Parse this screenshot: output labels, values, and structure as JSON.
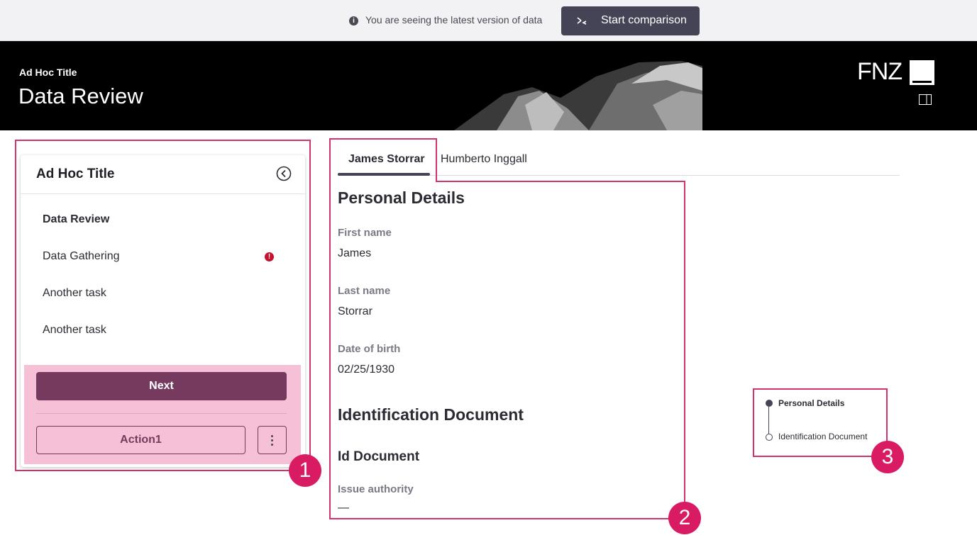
{
  "topbar": {
    "info_icon": "info-icon",
    "info_text": "You are seeing the latest version of data",
    "compare_icon": "compare-arrows-icon",
    "compare_label": "Start comparison"
  },
  "header": {
    "subtitle": "Ad Hoc Title",
    "title": "Data Review",
    "logo_text": "FNZ",
    "panel_icon": "side-panel-icon"
  },
  "sidebar": {
    "title": "Ad Hoc Title",
    "collapse_icon": "chevron-left-circle-icon",
    "items": [
      {
        "label": "Data Review",
        "active": true
      },
      {
        "label": "Data Gathering",
        "alert": true,
        "alert_icon": "error-icon"
      },
      {
        "label": "Another task"
      },
      {
        "label": "Another task"
      }
    ],
    "next_label": "Next",
    "action_label": "Action1",
    "more_icon": "more-vertical-icon"
  },
  "tabs": [
    {
      "label": "James Storrar",
      "active": true
    },
    {
      "label": "Humberto Inggall",
      "active": false
    }
  ],
  "content": {
    "personal_title": "Personal Details",
    "fields": [
      {
        "label": "First name",
        "value": "James"
      },
      {
        "label": "Last name",
        "value": "Storrar"
      },
      {
        "label": "Date of birth",
        "value": "02/25/1930"
      }
    ],
    "identification_title": "Identification Document",
    "id_document_title": "Id Document",
    "issue_authority_label": "Issue authority",
    "issue_authority_value": "—"
  },
  "stepper": {
    "steps": [
      {
        "label": "Personal Details",
        "active": true
      },
      {
        "label": "Identification Document",
        "active": false
      }
    ]
  },
  "annotations": {
    "badge_1": "1",
    "badge_2": "2",
    "badge_3": "3",
    "highlight_color": "#d0336e",
    "badge_color": "#d81b63"
  },
  "colors": {
    "primary_dark": "#454456",
    "button_plum": "#763a5e",
    "footer_pink": "#f6c1d6",
    "alert_red": "#c4122f"
  }
}
